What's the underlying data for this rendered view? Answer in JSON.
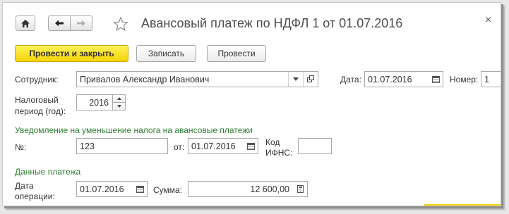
{
  "window": {
    "title": "Авансовый платеж по НДФЛ 1 от 01.07.2016",
    "close_glyph": "×"
  },
  "toolbar": {
    "post_and_close": "Провести и закрыть",
    "save": "Записать",
    "post": "Провести"
  },
  "form": {
    "employee_label": "Сотрудник:",
    "employee_value": "Привалов Александр Иванович",
    "date_label": "Дата:",
    "date_value": "01.07.2016",
    "number_label": "Номер:",
    "number_value": "1",
    "tax_period_label_1": "Налоговый",
    "tax_period_label_2": "период (год):",
    "tax_period_value": "2016"
  },
  "notice": {
    "section_title": "Уведомление на уменьшение налога на авансовые платежи",
    "number_label": "№:",
    "number_value": "123",
    "from_label": "от:",
    "from_value": "01.07.2016",
    "ifns_label_1": "Код",
    "ifns_label_2": "ИФНС:",
    "ifns_value": ""
  },
  "payment": {
    "section_title": "Данные платежа",
    "op_date_label_1": "Дата",
    "op_date_label_2": "операции:",
    "op_date_value": "01.07.2016",
    "sum_label": "Сумма:",
    "sum_value": "12 600,00"
  },
  "icons": {
    "home": "home-icon",
    "back": "arrow-left-icon",
    "forward": "arrow-right-icon",
    "favorite": "star-icon",
    "calendar": "calendar-icon",
    "calculator": "calculator-icon",
    "dropdown": "chevron-down-icon",
    "open": "open-icon"
  }
}
